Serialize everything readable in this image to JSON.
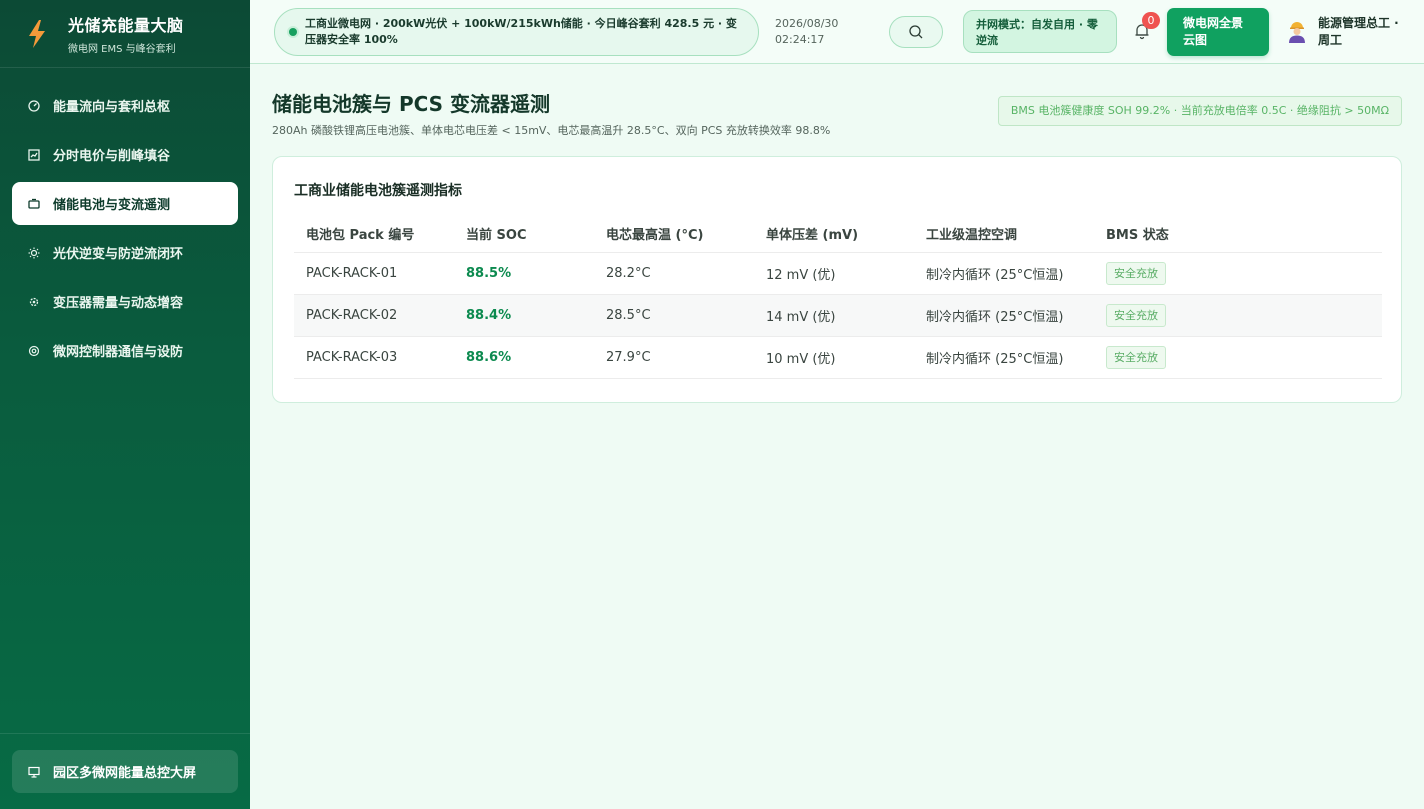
{
  "brand": {
    "title": "光储充能量大脑",
    "subtitle": "微电网 EMS 与峰谷套利"
  },
  "sidebar": {
    "items": [
      {
        "label": "能量流向与套利总枢",
        "icon": "gauge-icon",
        "active": false
      },
      {
        "label": "分时电价与削峰填谷",
        "icon": "chart-icon",
        "active": false
      },
      {
        "label": "储能电池与变流遥测",
        "icon": "battery-icon",
        "active": true
      },
      {
        "label": "光伏逆变与防逆流闭环",
        "icon": "sun-icon",
        "active": false
      },
      {
        "label": "变压器需量与动态增容",
        "icon": "gear-icon",
        "active": false
      },
      {
        "label": "微网控制器通信与设防",
        "icon": "settings-icon",
        "active": false
      }
    ],
    "bottom_label": "园区多微网能量总控大屏"
  },
  "header": {
    "status_text": "工商业微电网 · 200kW光伏 + 100kW/215kWh储能 · 今日峰谷套利 428.5 元 · 变压器安全率 100%",
    "date": "2026/08/30",
    "time": "02:24:17",
    "mode": "并网模式：自发自用 · 零逆流",
    "notifications": "0",
    "panorama_label": "微电网全景云图",
    "user_name": "能源管理总工 · 周工"
  },
  "page": {
    "title": "储能电池簇与 PCS 变流器遥测",
    "subtitle": "280Ah 磷酸铁锂高压电池簇、单体电芯电压差 < 15mV、电芯最高温升 28.5°C、双向 PCS 充放转换效率 98.8%",
    "health_badge": "BMS 电池簇健康度 SOH 99.2% · 当前充放电倍率 0.5C · 绝缘阻抗 > 50MΩ"
  },
  "card": {
    "title": "工商业储能电池簇遥测指标",
    "columns": [
      "电池包 Pack 编号",
      "当前 SOC",
      "电芯最高温 (°C)",
      "单体压差 (mV)",
      "工业级温控空调",
      "BMS 状态"
    ],
    "rows": [
      {
        "pack": "PACK-RACK-01",
        "soc": "88.5%",
        "temp": "28.2°C",
        "diff": "12 mV (优)",
        "hvac": "制冷内循环 (25°C恒温)",
        "status": "安全充放"
      },
      {
        "pack": "PACK-RACK-02",
        "soc": "88.4%",
        "temp": "28.5°C",
        "diff": "14 mV (优)",
        "hvac": "制冷内循环 (25°C恒温)",
        "status": "安全充放"
      },
      {
        "pack": "PACK-RACK-03",
        "soc": "88.6%",
        "temp": "27.9°C",
        "diff": "10 mV (优)",
        "hvac": "制冷内循环 (25°C恒温)",
        "status": "安全充放"
      }
    ]
  },
  "colors": {
    "accent": "#10a160",
    "sidebar": "#0a5c3e",
    "soc": "#0c8a4f",
    "badge_bg": "#ef5350"
  }
}
